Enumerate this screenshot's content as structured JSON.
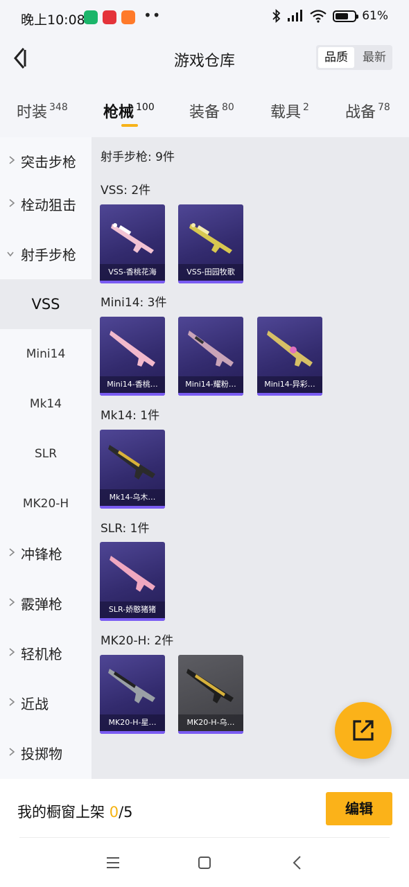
{
  "status_bar": {
    "time": "晚上10:08",
    "battery": "61%"
  },
  "header": {
    "title": "游戏仓库",
    "sort_options": [
      "品质",
      "最新"
    ]
  },
  "tabs": [
    {
      "label": "时装",
      "count": "348"
    },
    {
      "label": "枪械",
      "count": "100"
    },
    {
      "label": "装备",
      "count": "80"
    },
    {
      "label": "载具",
      "count": "2"
    },
    {
      "label": "战备",
      "count": "78"
    }
  ],
  "sidebar": {
    "categories": [
      "突击步枪",
      "栓动狙击",
      "射手步枪",
      "冲锋枪",
      "霰弹枪",
      "轻机枪",
      "近战",
      "投掷物"
    ],
    "subcategories": [
      "VSS",
      "Mini14",
      "Mk14",
      "SLR",
      "MK20-H"
    ]
  },
  "content": {
    "summary": "射手步枪: 9件",
    "groups": [
      {
        "title": "VSS: 2件",
        "items": [
          "VSS-香桃花海",
          "VSS-田园牧歌"
        ]
      },
      {
        "title": "Mini14: 3件",
        "items": [
          "Mini14-香桃…",
          "Mini14-耀粉…",
          "Mini14-异彩…"
        ]
      },
      {
        "title": "Mk14: 1件",
        "items": [
          "Mk14-乌木…"
        ]
      },
      {
        "title": "SLR: 1件",
        "items": [
          "SLR-娇憨猪猪"
        ]
      },
      {
        "title": "MK20-H: 2件",
        "items": [
          "MK20-H-星…",
          "MK20-H-乌…"
        ]
      }
    ]
  },
  "bottom": {
    "label": "我的橱窗上架",
    "count": "0",
    "total": "/5",
    "edit": "编辑"
  },
  "colors": {
    "accent": "#fbb219",
    "card_purple": "#3a3178"
  }
}
